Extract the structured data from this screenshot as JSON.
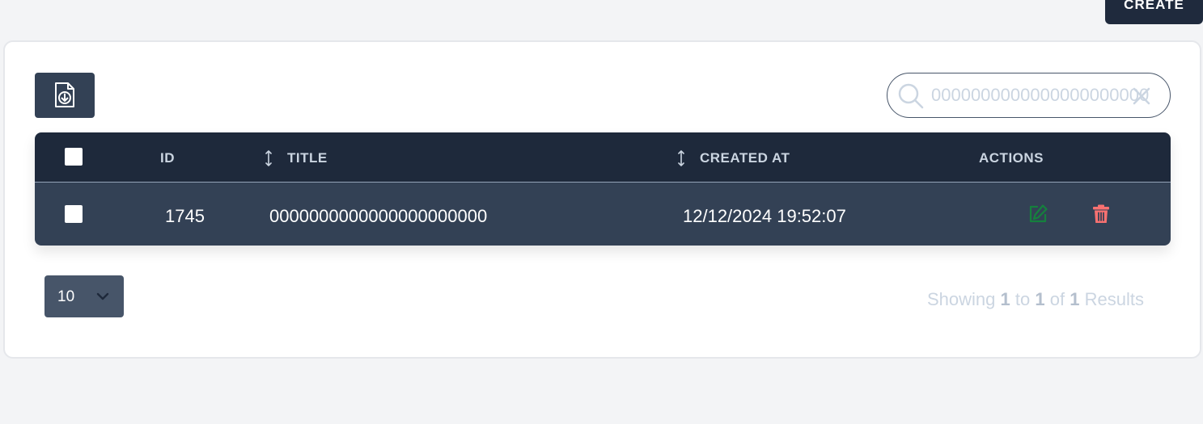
{
  "header": {
    "create_label": "CREATE"
  },
  "toolbar": {
    "export_icon": "file-download-icon",
    "search": {
      "value": "0000000000000000000000",
      "icon": "search-icon",
      "clear_icon": "close-icon"
    }
  },
  "table": {
    "columns": [
      {
        "label": "ID",
        "sortable": false
      },
      {
        "label": "TITLE",
        "sortable": true
      },
      {
        "label": "CREATED AT",
        "sortable": true
      },
      {
        "label": "ACTIONS",
        "sortable": false
      }
    ],
    "rows": [
      {
        "id": "1745",
        "title": "0000000000000000000000",
        "created_at": "12/12/2024 19:52:07",
        "actions": [
          "edit-icon",
          "trash-icon"
        ]
      }
    ]
  },
  "pagination": {
    "per_page": "10",
    "showing_prefix": "Showing",
    "from": "1",
    "to_word": "to",
    "to": "1",
    "of_word": "of",
    "total": "1",
    "results_word": "Results"
  },
  "colors": {
    "header_dark": "#1e293b",
    "row_bg": "#334155",
    "edit_green": "#15803d",
    "delete_red": "#f87171",
    "page_bg": "#f3f4f6"
  }
}
